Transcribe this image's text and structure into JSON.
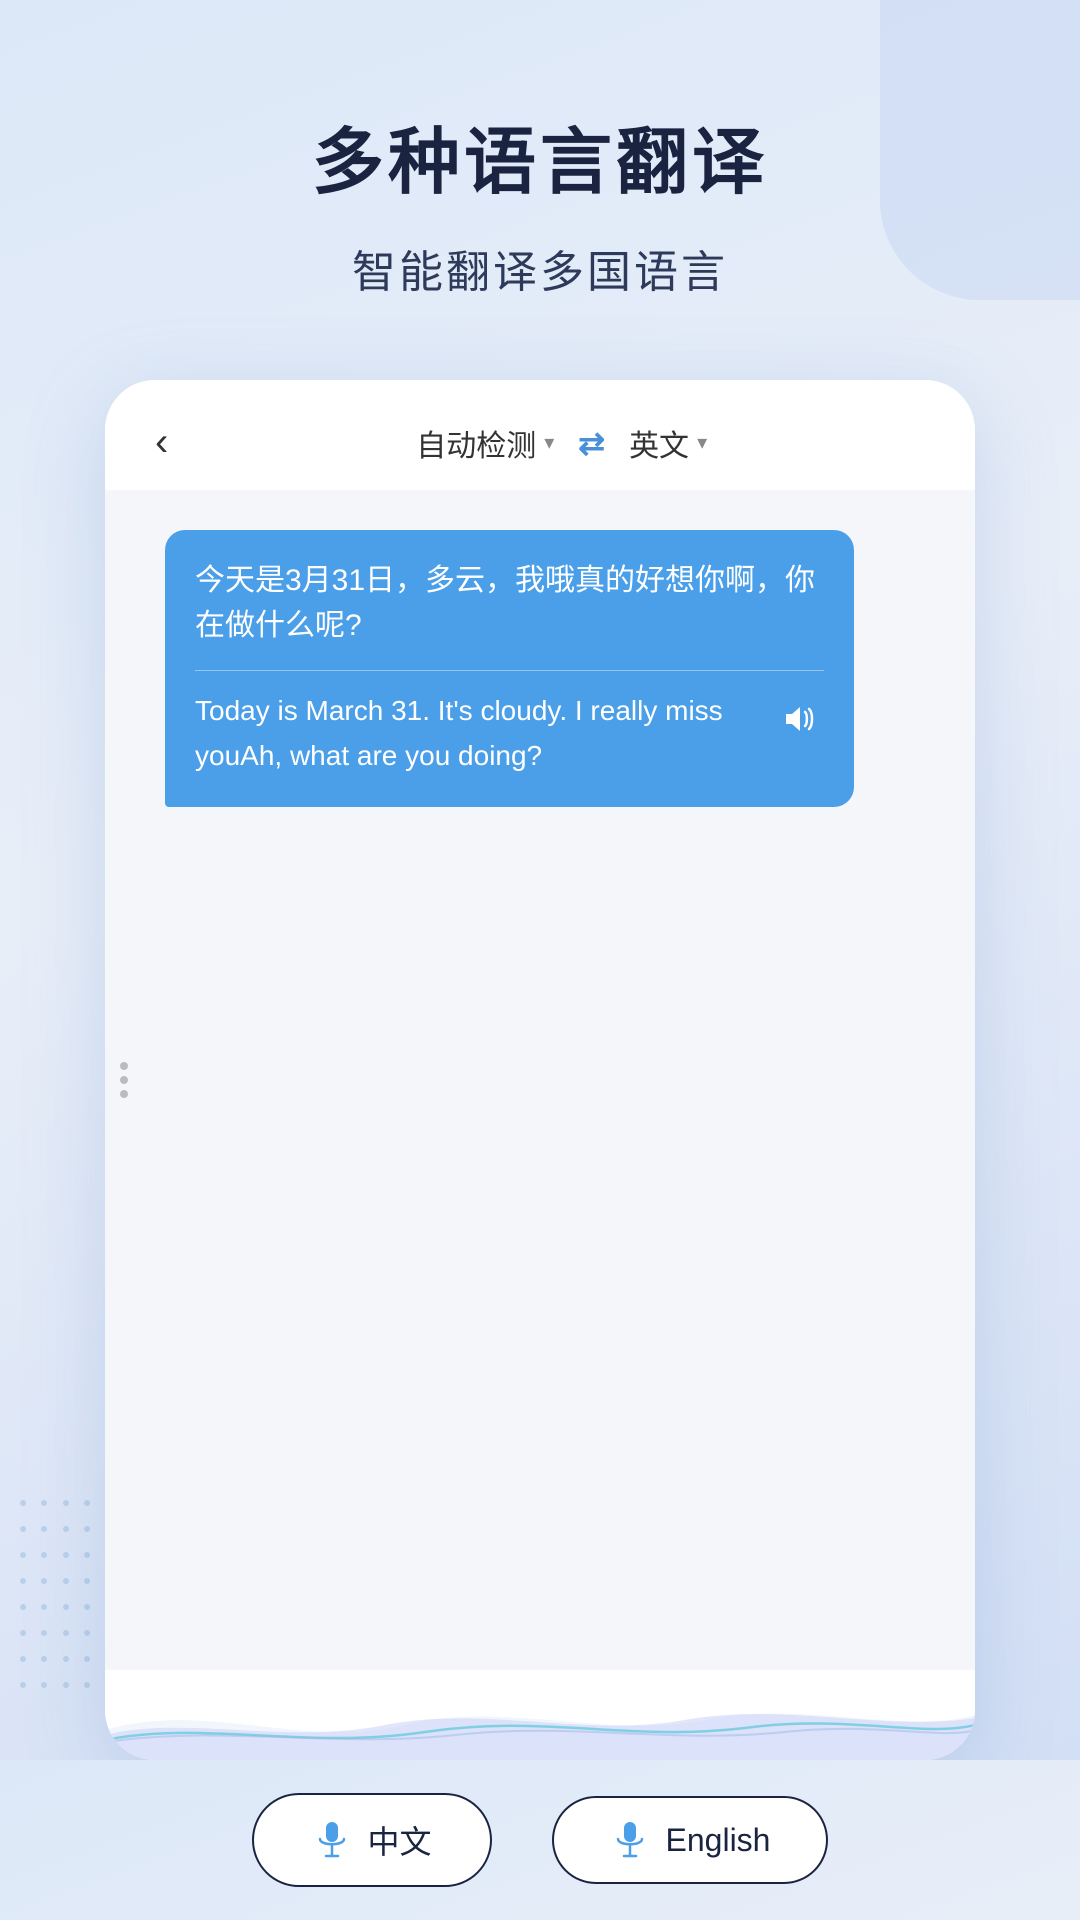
{
  "page": {
    "title": "多种语言翻译",
    "subtitle": "智能翻译多国语言",
    "bg_color": "#dce8f8",
    "accent_color": "#4a9fe8"
  },
  "mockup": {
    "back_label": "‹",
    "source_lang": "自动检测",
    "target_lang": "英文",
    "swap_icon": "⇄",
    "source_lang_arrow": "▼",
    "target_lang_arrow": "▼"
  },
  "chat": {
    "message": {
      "original": "今天是3月31日，多云，我哦真的好想你啊，你在做什么呢?",
      "translation": "Today is March 31. It's cloudy. I really miss youAh, what are you doing?"
    },
    "dots": [
      "•",
      "•",
      "•"
    ]
  },
  "bottom_buttons": [
    {
      "id": "chinese",
      "label": "中文",
      "lang_code": "zh"
    },
    {
      "id": "english",
      "label": "English",
      "lang_code": "en"
    }
  ]
}
